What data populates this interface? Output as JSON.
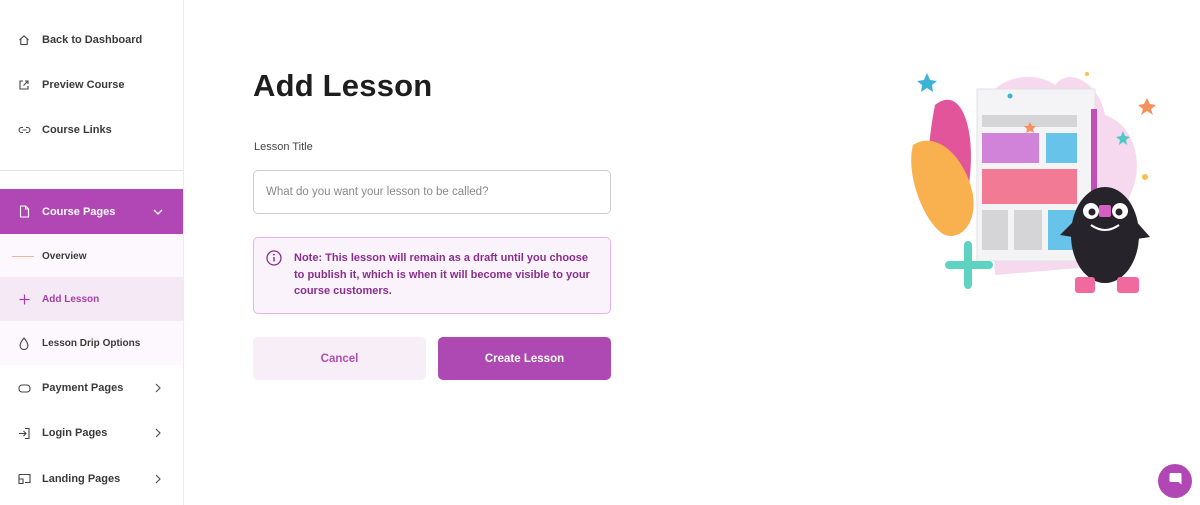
{
  "sidebar": {
    "top_items": [
      {
        "label": "Back to Dashboard",
        "icon": "home-icon"
      },
      {
        "label": "Preview Course",
        "icon": "external-link-icon"
      },
      {
        "label": "Course Links",
        "icon": "link-icon"
      }
    ],
    "course_pages": {
      "label": "Course Pages",
      "icon": "page-icon",
      "expanded": true
    },
    "sub_items": [
      {
        "label": "Overview"
      },
      {
        "label": "Add Lesson",
        "current": true
      },
      {
        "label": "Lesson Drip Options"
      }
    ],
    "bottom_items": [
      {
        "label": "Payment Pages",
        "icon": "tag-icon"
      },
      {
        "label": "Login Pages",
        "icon": "login-icon"
      },
      {
        "label": "Landing Pages",
        "icon": "landing-icon"
      }
    ]
  },
  "main": {
    "title": "Add Lesson",
    "lesson_title_label": "Lesson Title",
    "lesson_title_value": "",
    "lesson_title_placeholder": "What do you want your lesson to be called?",
    "note": "Note: This lesson will remain as a draft until you choose to publish it, which is when it will become visible to your course customers.",
    "cancel_label": "Cancel",
    "create_label": "Create Lesson"
  },
  "colors": {
    "accent": "#b147b5",
    "accent_light": "#f8eef8",
    "note_text": "#8a2d8e",
    "note_border": "#e9b3ea"
  }
}
